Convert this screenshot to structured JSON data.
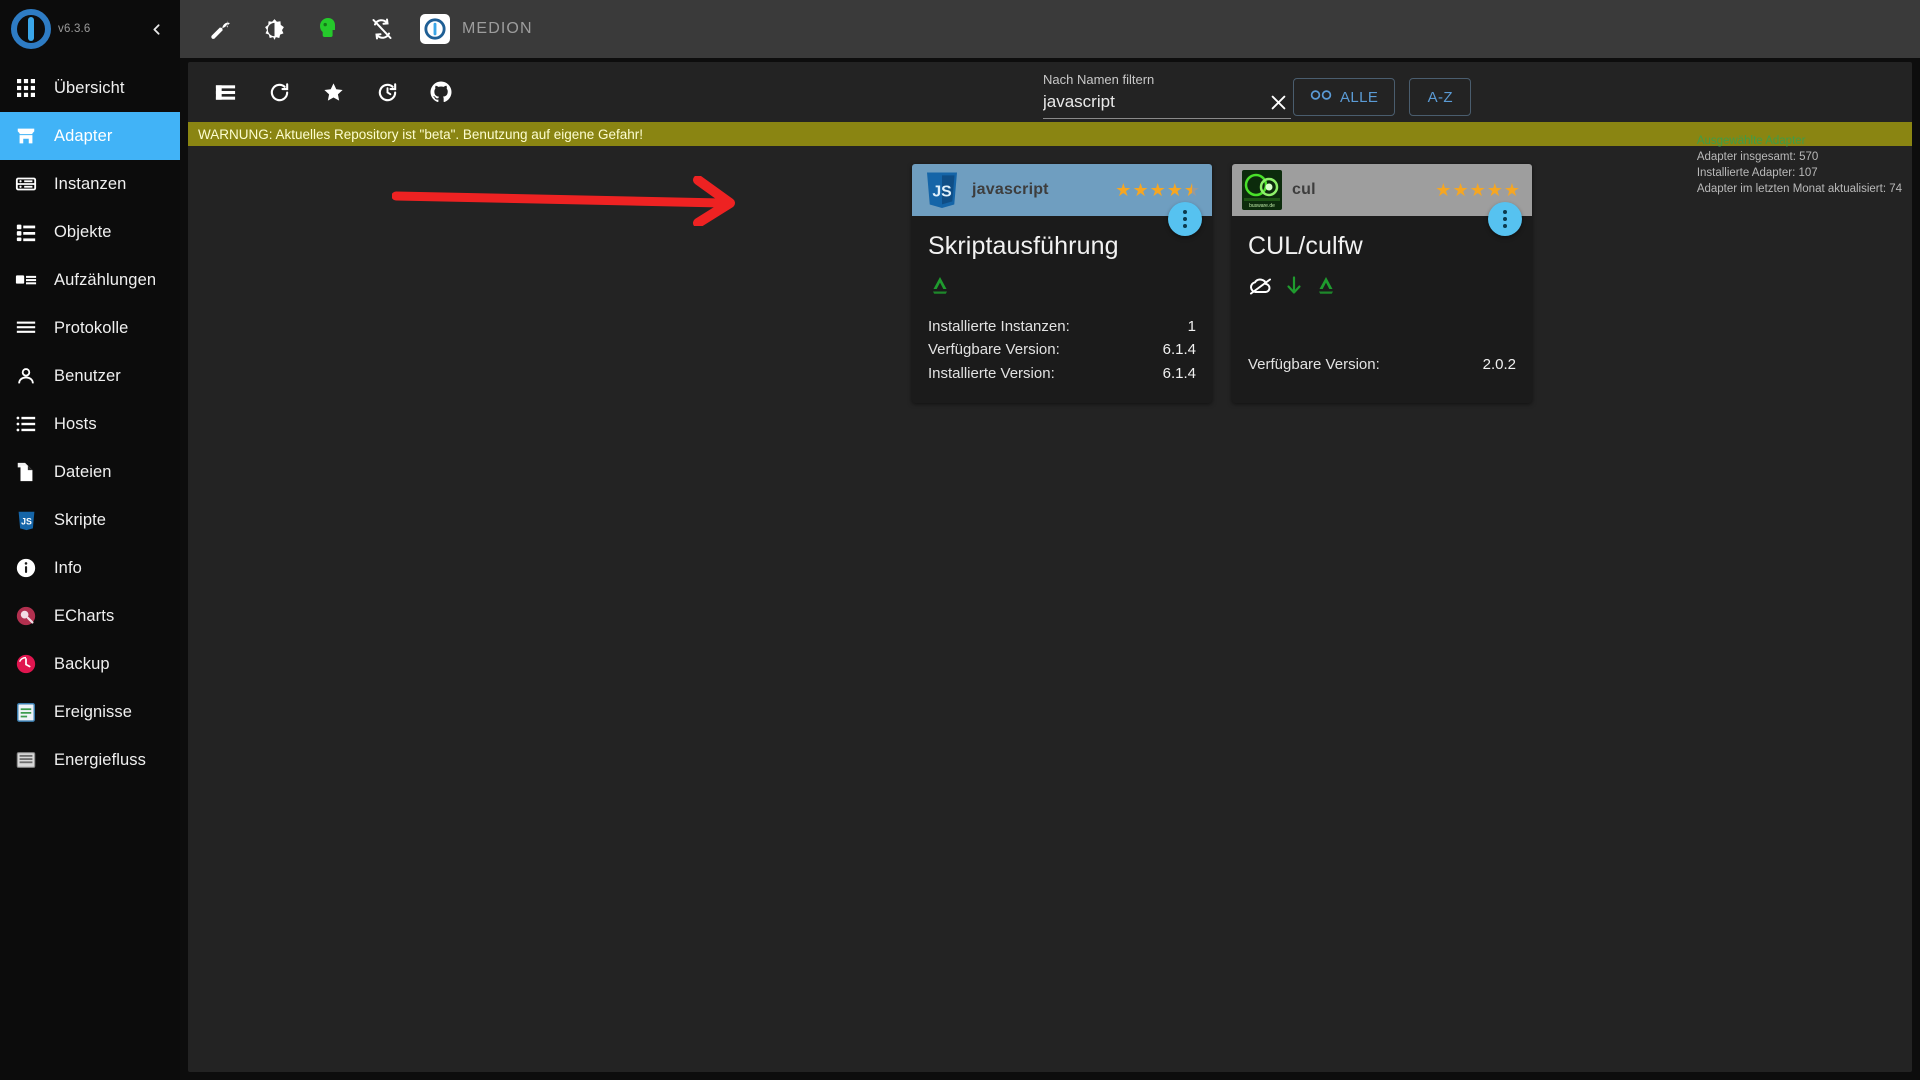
{
  "sidebar": {
    "version": "v6.3.6",
    "collapse_icon": "chevron-left-icon",
    "items": [
      {
        "label": "Übersicht",
        "icon": "grid-icon",
        "active": false
      },
      {
        "label": "Adapter",
        "icon": "store-icon",
        "active": true
      },
      {
        "label": "Instanzen",
        "icon": "instances-icon",
        "active": false
      },
      {
        "label": "Objekte",
        "icon": "list-bullet-icon",
        "active": false
      },
      {
        "label": "Aufzählungen",
        "icon": "enums-icon",
        "active": false
      },
      {
        "label": "Protokolle",
        "icon": "log-lines-icon",
        "active": false
      },
      {
        "label": "Benutzer",
        "icon": "person-icon",
        "active": false
      },
      {
        "label": "Hosts",
        "icon": "hosts-icon",
        "active": false
      },
      {
        "label": "Dateien",
        "icon": "files-icon",
        "active": false
      },
      {
        "label": "Skripte",
        "icon": "js-icon",
        "active": false
      },
      {
        "label": "Info",
        "icon": "info-icon",
        "active": false
      },
      {
        "label": "ECharts",
        "icon": "echarts-icon",
        "active": false
      },
      {
        "label": "Backup",
        "icon": "backup-clock-icon",
        "active": false
      },
      {
        "label": "Ereignisse",
        "icon": "events-icon",
        "active": false
      },
      {
        "label": "Energiefluss",
        "icon": "energy-flow-icon",
        "active": false
      }
    ]
  },
  "topbar": {
    "icons": [
      "wrench-icon",
      "brightness-icon",
      "head-green-icon",
      "no-sync-icon"
    ],
    "host_name": "MEDION",
    "host_logo_icon": "iobroker-logo-icon"
  },
  "toolbar": {
    "icons": [
      "list-view-icon",
      "refresh-icon",
      "star-icon",
      "update-history-icon",
      "github-icon"
    ]
  },
  "filter": {
    "label": "Nach Namen filtern",
    "value": "javascript",
    "placeholder": "Nach Namen filtern",
    "clear_icon": "close-icon"
  },
  "buttons": {
    "all": {
      "label": "ALLE",
      "icon": "infinity-icon"
    },
    "az": {
      "label": "A-Z"
    }
  },
  "stats": {
    "title": "Ausgewählte Adapter",
    "rows": [
      "Adapter insgesamt: 570",
      "Installierte Adapter: 107",
      "Adapter im letzten Monat aktualisiert: 74"
    ]
  },
  "warning": {
    "text": "WARNUNG: Aktuelles Repository ist \"beta\". Benutzung auf eigene Gefahr!"
  },
  "cards": [
    {
      "id": "javascript",
      "header_name": "javascript",
      "logo_icon": "javascript-logo-icon",
      "rating_full": 4,
      "rating_half": true,
      "title": "Skriptausführung",
      "status_icons": [
        "green-signal-icon"
      ],
      "rows": [
        {
          "key": "Installierte Instanzen:",
          "value": "1"
        },
        {
          "key": "Verfügbare Version:",
          "value": "6.1.4"
        },
        {
          "key": "Installierte Version:",
          "value": "6.1.4"
        }
      ]
    },
    {
      "id": "cul",
      "header_name": "cul",
      "logo_icon": "cul-logo-icon",
      "rating_full": 5,
      "rating_half": false,
      "title": "CUL/culfw",
      "status_icons": [
        "cloud-off-icon",
        "download-arrow-icon",
        "green-signal-icon"
      ],
      "rows": [
        {
          "key": "Verfügbare Version:",
          "value": "2.0.2"
        }
      ]
    }
  ],
  "annotation": {
    "arrow_color": "#ee2222",
    "arrow_name": "red-pointer-arrow"
  },
  "colors": {
    "accent": "#41b3f7",
    "warning_bg": "#8a8512",
    "fab": "#56c2f0",
    "star": "#f5a623"
  }
}
